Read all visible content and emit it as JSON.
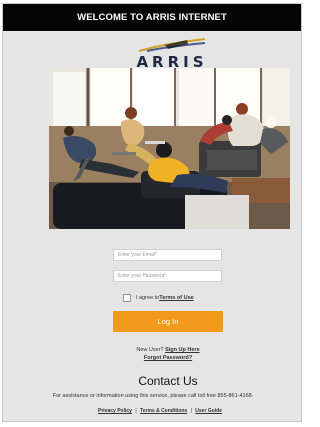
{
  "header": {
    "title": "WELCOME TO ARRIS INTERNET"
  },
  "brand": {
    "logo_text": "ARRIS",
    "logo_color": "#1f2a44",
    "accent_color": "#f19a1b"
  },
  "hero": {
    "icon": "office-lounge-photo"
  },
  "form": {
    "email_placeholder": "Enter your Email*",
    "password_placeholder": "Enter your Password*",
    "terms_prefix": "I agree to ",
    "terms_link": "Terms of Use",
    "login_label": "Log In"
  },
  "account": {
    "new_user_prefix": "New User? ",
    "signup_label": "Sign Up Here",
    "forgot_label": "Forgot Password?"
  },
  "contact": {
    "title": "Contact Us",
    "assistance": "For assistance or information using this service, please call toll free 855-861-4168."
  },
  "footer": {
    "privacy": "Privacy Policy",
    "terms_conditions": "Terms & Conditions",
    "user_guide": "User Guide",
    "separator": "|"
  }
}
